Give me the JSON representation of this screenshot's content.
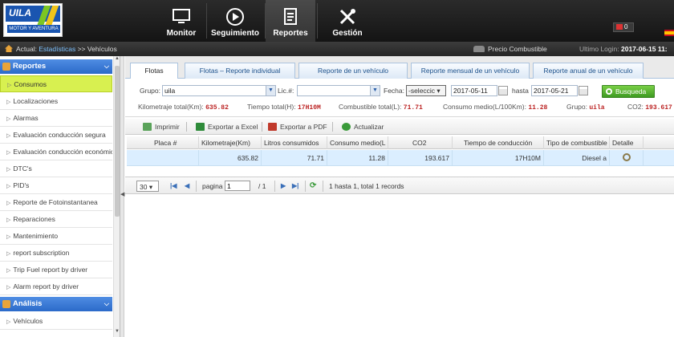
{
  "brand": {
    "logo_text": "UILA",
    "logo_sub": "MOTOR Y AVENTURA"
  },
  "nav": {
    "items": [
      {
        "label": "Monitor",
        "icon": "monitor-icon"
      },
      {
        "label": "Seguimiento",
        "icon": "play-circle-icon"
      },
      {
        "label": "Reportes",
        "icon": "document-icon"
      },
      {
        "label": "Gestión",
        "icon": "tools-icon"
      }
    ],
    "active": "Reportes",
    "messages_count": "0"
  },
  "breadcrumb": {
    "prefix": "Actual:",
    "link": "Estadísticas",
    "separator": ">>",
    "current": "Vehículos",
    "fuel_price": "Precio Combustible",
    "last_login_label": "Ultimo Login:",
    "last_login_value": "2017-06-15 11:"
  },
  "sidebar": {
    "section1": {
      "title": "Reportes"
    },
    "items": [
      "Consumos",
      "Localizaciones",
      "Alarmas",
      "Evaluación conducción segura",
      "Evaluación conducción económica",
      "DTC's",
      "PID's",
      "Reporte de Fotoinstantanea",
      "Reparaciones",
      "Mantenimiento",
      "report subscription",
      "Trip Fuel report by driver",
      "Alarm report by driver"
    ],
    "active_item": "Consumos",
    "section2": {
      "title": "Análisis"
    },
    "items2": [
      "Vehículos"
    ]
  },
  "tabs": [
    "Flotas",
    "Flotas – Reporte individual",
    "Reporte de un vehículo",
    "Reporte mensual de un vehículo",
    "Reporte anual de un vehículo"
  ],
  "filters": {
    "group_label": "Grupo:",
    "group_value": "uila",
    "plate_label": "Lic.#:",
    "plate_value": "",
    "date_label": "Fecha:",
    "date_mode": "-seleccic",
    "date_from": "2017-05-11",
    "until_label": "hasta",
    "date_to": "2017-05-21",
    "search_label": "Busqueda"
  },
  "summary": {
    "mileage_label": "Kilometraje total(Km):",
    "mileage_value": "635.82",
    "time_label": "Tiempo total(H):",
    "time_value": "17H10M",
    "fuel_label": "Combustible total(L):",
    "fuel_value": "71.71",
    "avg_label": "Consumo medio(L/100Km):",
    "avg_value": "11.28",
    "group_label": "Grupo:",
    "group_value": "uila",
    "co2_label": "CO2:",
    "co2_value": "193.617"
  },
  "toolbar": {
    "print": "Imprimir",
    "excel": "Exportar a Excel",
    "pdf": "Exportar a PDF",
    "refresh": "Actualizar"
  },
  "table": {
    "columns": [
      "Placa #",
      "Kilometraje(Km)",
      "Litros consumidos",
      "Consumo medio(L",
      "CO2",
      "Tiempo de conducción",
      "Tipo de combustible",
      "Detalle"
    ],
    "rows": [
      [
        "",
        "635.82",
        "71.71",
        "11.28",
        "193.617",
        "17H10M",
        "Diesel a",
        ""
      ]
    ]
  },
  "pager": {
    "page_size": "30",
    "page_label": "pagina",
    "page_value": "1",
    "of_pages": "/ 1",
    "info": "1 hasta 1, total 1 records"
  },
  "colors": {
    "accent": "#2b6ac9",
    "active_item": "#d8f050",
    "value_red": "#bb2222",
    "row_selected": "#dbeeff"
  }
}
